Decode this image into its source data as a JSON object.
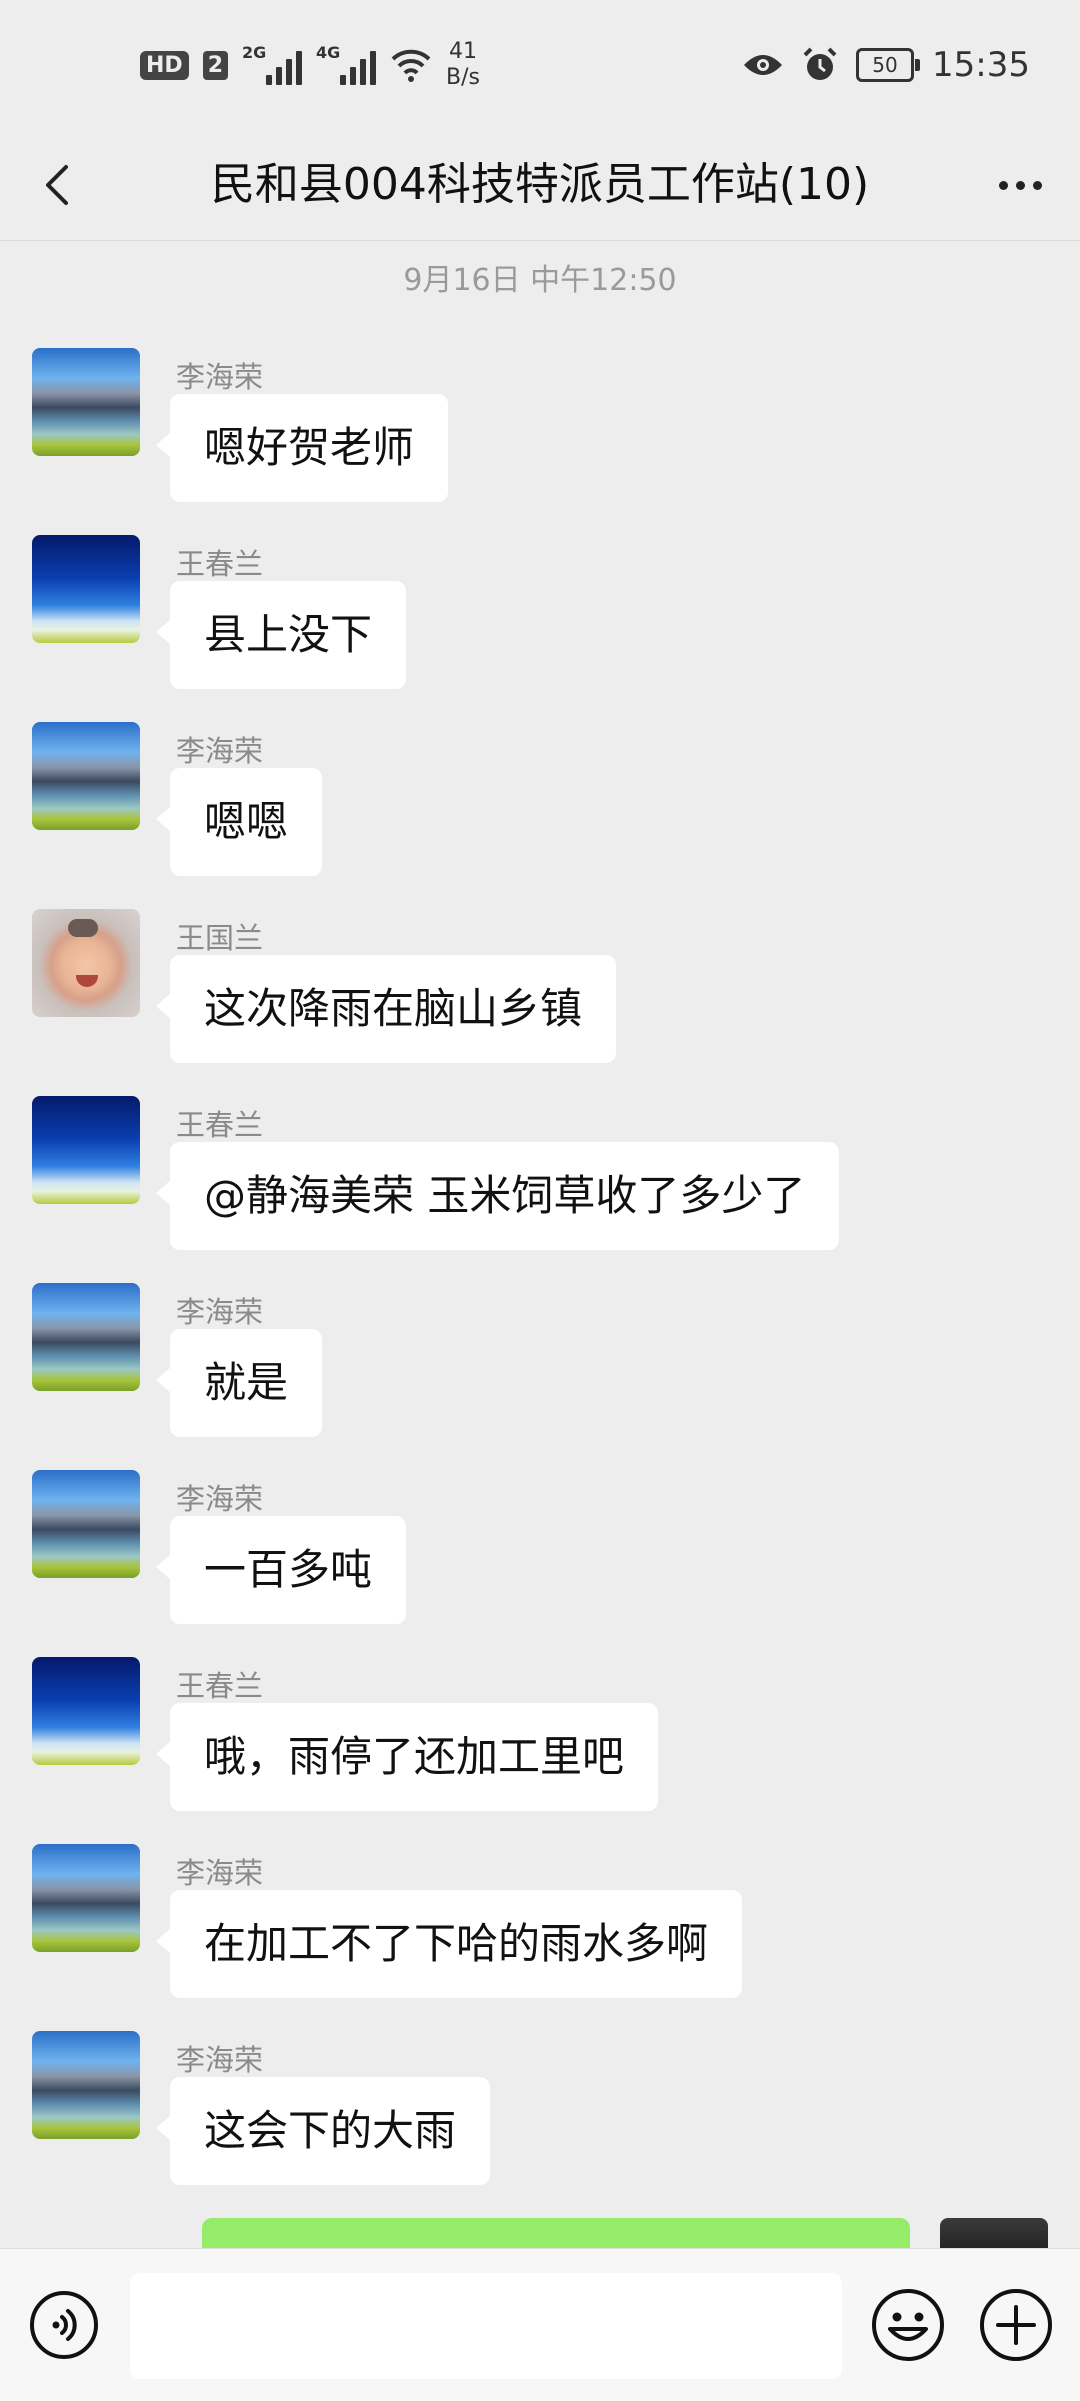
{
  "status_bar": {
    "hd_label": "HD",
    "hd_sim": "2",
    "signal_1": "2G",
    "signal_2": "4G",
    "speed_value": "41",
    "speed_unit": "B/s",
    "battery": "50",
    "time": "15:35"
  },
  "header": {
    "title": "民和县004科技特派员工作站(10)"
  },
  "timestamp": "9月16日 中午12:50",
  "messages": [
    {
      "sender": "李海荣",
      "text": "嗯好贺老师",
      "avatar": "mountain-lake"
    },
    {
      "sender": "王春兰",
      "text": "县上没下",
      "avatar": "blue-sky"
    },
    {
      "sender": "李海荣",
      "text": "嗯嗯",
      "avatar": "mountain-lake"
    },
    {
      "sender": "王国兰",
      "text": "这次降雨在脑山乡镇",
      "avatar": "baby"
    },
    {
      "sender": "王春兰",
      "text": "@静海美荣  玉米饲草收了多少了",
      "avatar": "blue-sky"
    },
    {
      "sender": "李海荣",
      "text": "就是",
      "avatar": "mountain-lake"
    },
    {
      "sender": "李海荣",
      "text": "一百多吨",
      "avatar": "mountain-lake"
    },
    {
      "sender": "王春兰",
      "text": "哦，雨停了还加工里吧",
      "avatar": "blue-sky"
    },
    {
      "sender": "李海荣",
      "text": "在加工不了下哈的雨水多啊",
      "avatar": "mountain-lake"
    },
    {
      "sender": "李海荣",
      "text": "这会下的大雨",
      "avatar": "mountain-lake"
    }
  ],
  "input": {
    "placeholder": ""
  },
  "colors": {
    "background": "#ededed",
    "bubble_other": "#ffffff",
    "bubble_self": "#95ec69"
  }
}
